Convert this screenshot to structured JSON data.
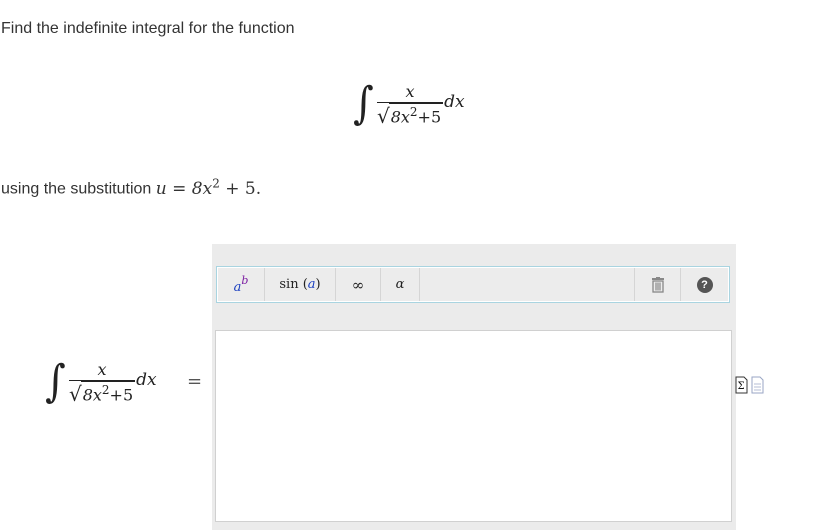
{
  "question": {
    "intro": "Find the indefinite integral for the function",
    "substitution_prefix": "using the substitution",
    "substitution_var": "u",
    "substitution_eq": "=",
    "substitution_expr_base": "8x",
    "substitution_expr_exp": "2",
    "substitution_expr_tail": "+ 5.",
    "integral": {
      "sign": "∫",
      "numerator": "x",
      "radicand_base": "8x",
      "radicand_exp": "2",
      "radicand_tail": "+5",
      "differential": "dx"
    }
  },
  "answer": {
    "equals": "=",
    "toolbar": {
      "superscript_base": "a",
      "superscript_exp": "b",
      "sin_label": "sin",
      "sin_arg": "a",
      "infinity": "∞",
      "alpha": "α"
    }
  },
  "colors": {
    "toolbar_border": "#a9d4e0",
    "panel_bg": "#ebebeb",
    "superscript_base": "#1a3fc0",
    "superscript_exp": "#7a1aa0"
  }
}
